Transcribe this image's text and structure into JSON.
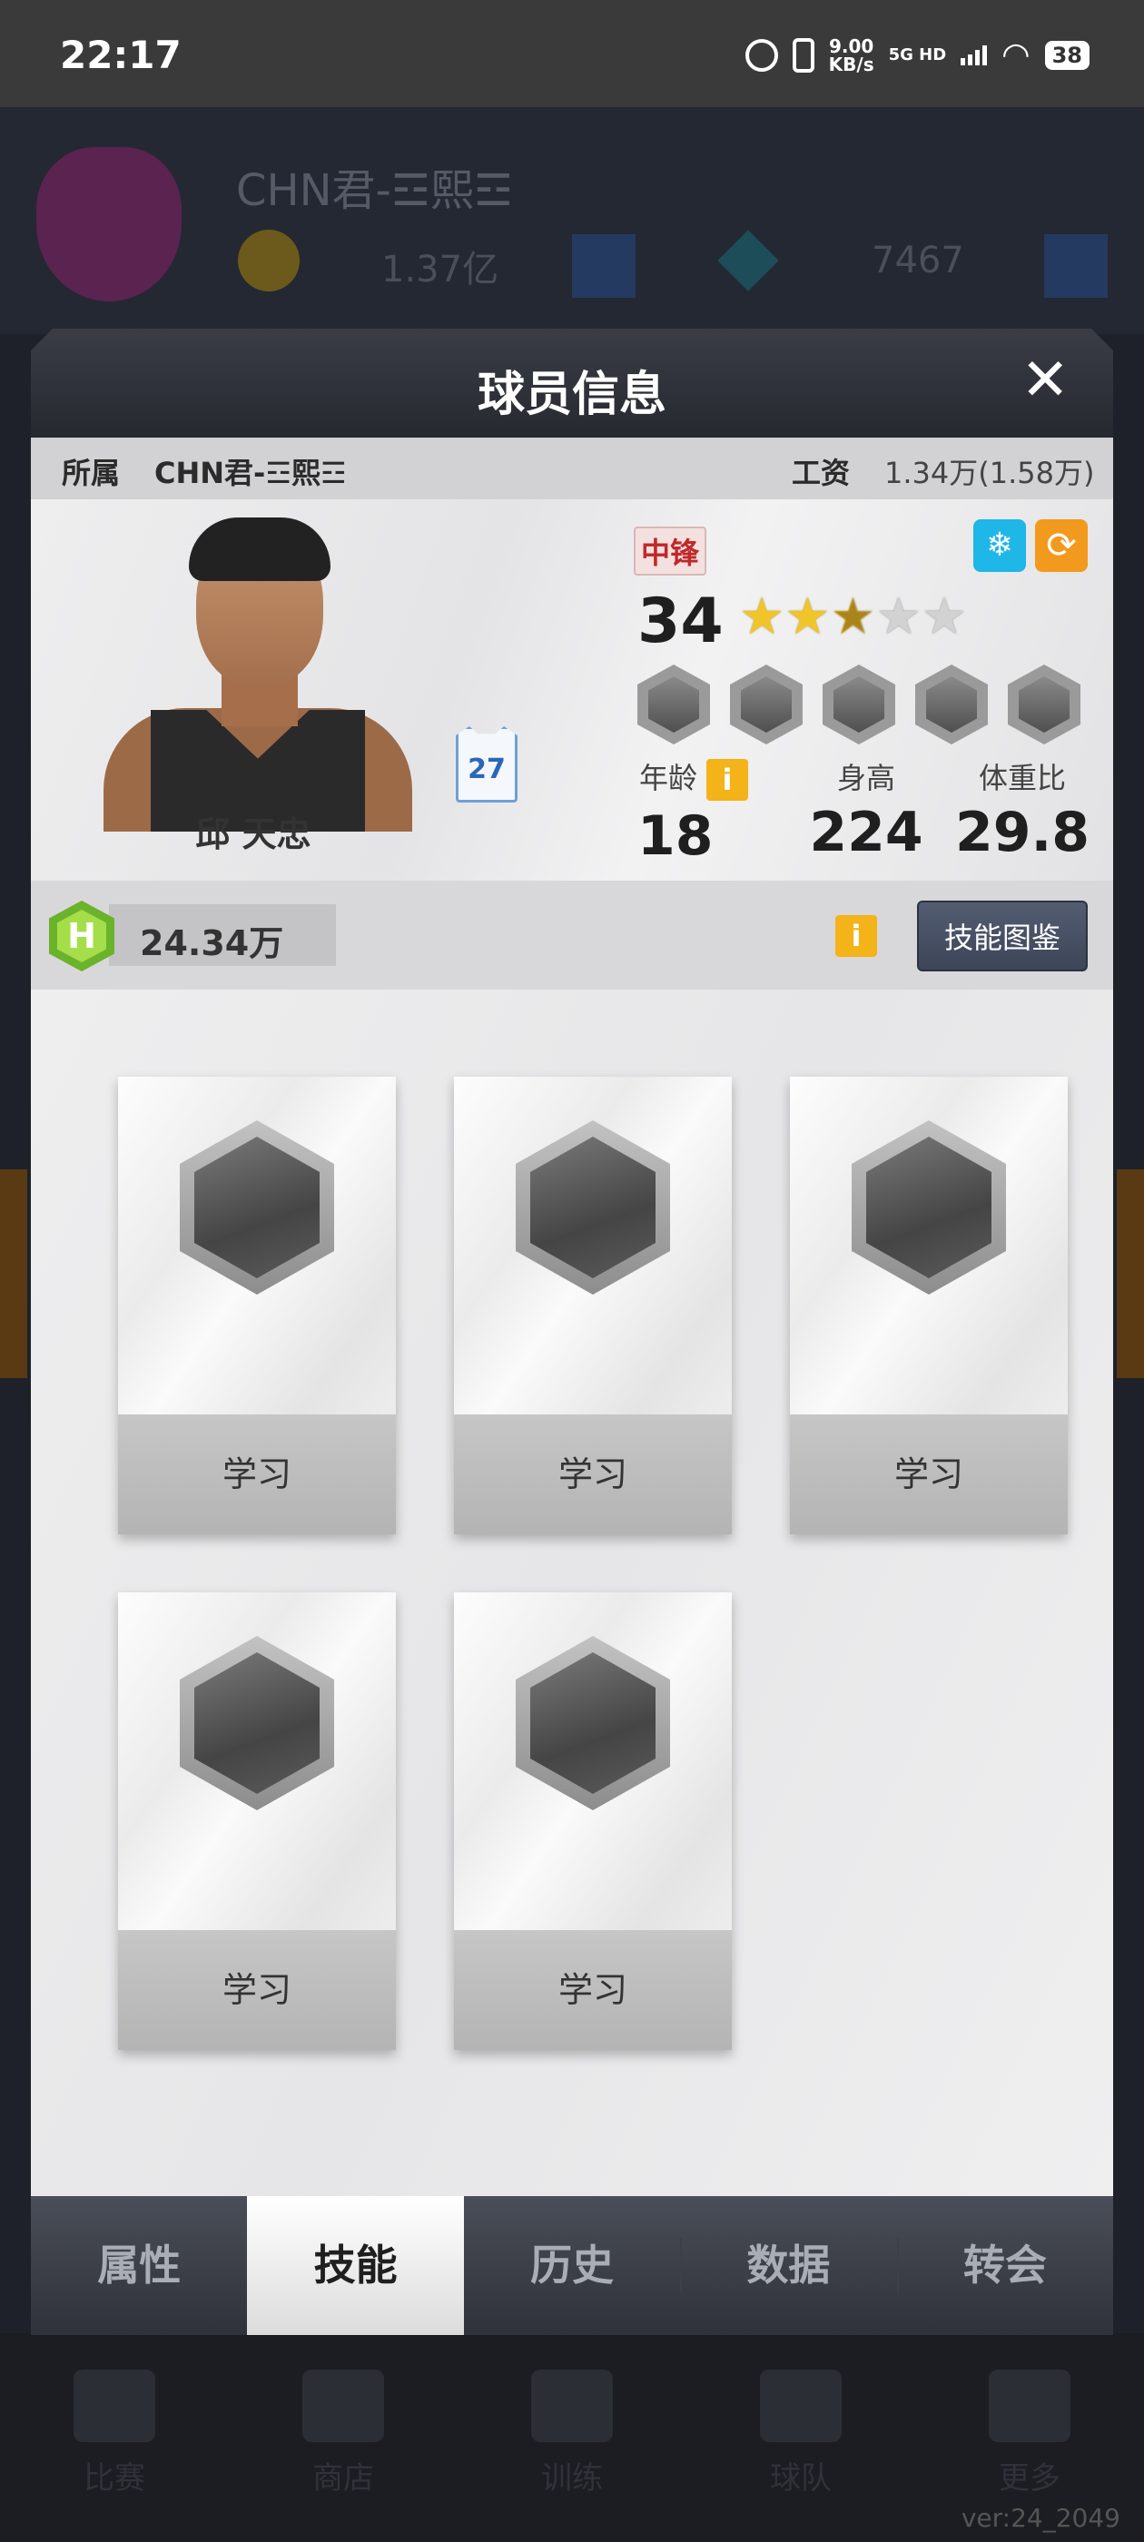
{
  "status_bar": {
    "time": "22:17",
    "net_speed": "9.00",
    "net_unit": "KB/s",
    "network": "5G HD",
    "battery": "38"
  },
  "background": {
    "team_name": "CHN君-☲熙☲",
    "coins": "1.37亿",
    "gems": "7467",
    "nav": [
      "比赛",
      "商店",
      "训练",
      "球队",
      "更多"
    ],
    "version": "ver:24_2049"
  },
  "modal": {
    "title": "球员信息",
    "team_label": "所属",
    "team_value": "CHN君-☲熙☲",
    "salary_label": "工资",
    "salary_value": "1.34万(1.58万)",
    "player_name": "邱 天忠",
    "jersey_number": "27",
    "position": "中锋",
    "rating": "34",
    "stars": 2.5,
    "stars_max": 5,
    "age_label": "年龄",
    "age": "18",
    "height_label": "身高",
    "height": "224",
    "weight_label": "体重比",
    "weight": "29.8",
    "h_currency_icon": "H",
    "h_currency": "24.34万",
    "info_icon": "i",
    "skill_guide": "技能图鉴",
    "learn_label": "学习",
    "skill_slots": 5,
    "tabs": [
      "属性",
      "技能",
      "历史",
      "数据",
      "转会"
    ],
    "active_tab": 1
  }
}
